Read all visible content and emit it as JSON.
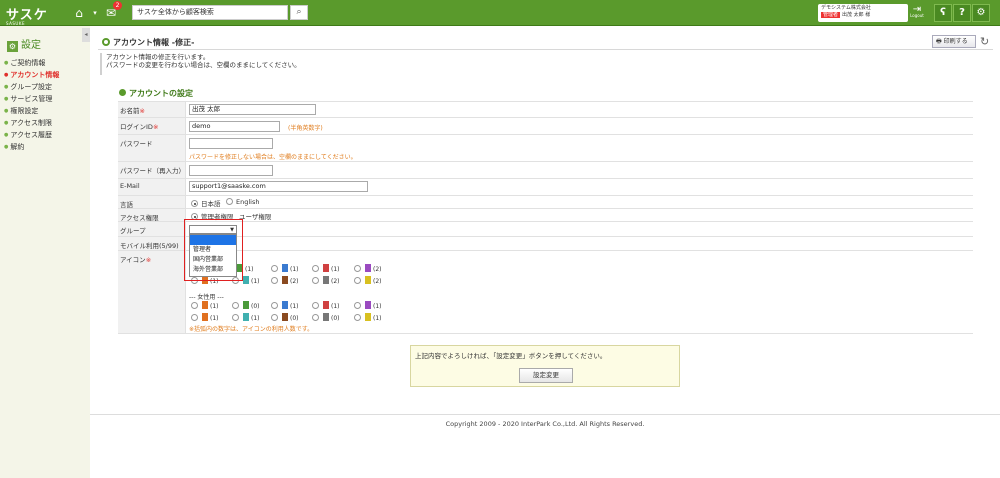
{
  "header": {
    "logo_text": "サスケ",
    "logo_sub": "SASUKE",
    "notification_count": "2",
    "search_placeholder": "サスケ全体から顧客検索",
    "company": "デモシステム株式会社",
    "role": "管理者",
    "user_name": "出茂 太郎 様",
    "logout_label": "Logout",
    "help_label": "?"
  },
  "sidebar": {
    "title": "設定",
    "items": [
      {
        "label": "ご契約情報",
        "active": false
      },
      {
        "label": "アカウント情報",
        "active": true
      },
      {
        "label": "グループ設定",
        "active": false
      },
      {
        "label": "サービス管理",
        "active": false
      },
      {
        "label": "権限設定",
        "active": false
      },
      {
        "label": "アクセス制限",
        "active": false
      },
      {
        "label": "アクセス履歴",
        "active": false
      },
      {
        "label": "解約",
        "active": false
      }
    ]
  },
  "page": {
    "title": "アカウント情報 -修正-",
    "print_label": "印刷する",
    "desc_line1": "アカウント情報の修正を行います。",
    "desc_line2": "パスワードの変更を行わない場合は、空欄のままにしてください。",
    "section_title": "アカウントの設定"
  },
  "form": {
    "name_label": "お名前",
    "name_value": "出茂 太郎",
    "login_label": "ログインID",
    "login_value": "demo",
    "login_note": "(半角英数字)",
    "password_label": "パスワード",
    "password_note": "パスワードを修正しない場合は、空欄のままにしてください。",
    "password2_label": "パスワード（再入力）",
    "email_label": "E-Mail",
    "email_value": "support1@saaske.com",
    "lang_label": "言語",
    "lang_options": [
      "日本語",
      "English"
    ],
    "access_label": "アクセス権限",
    "access_options": [
      "管理者権限",
      "ユーザ権限"
    ],
    "group_label": "グループ",
    "group_options": [
      "",
      "管理者",
      "国内営業部",
      "海外営業部"
    ],
    "mobile_label": "モバイル利用(5/99)",
    "icon_label": "アイコン",
    "required_mark": "※",
    "female_label": "--- 女性用 ---",
    "icon_note": "※括弧内の数字は、アイコンの利用人数です。",
    "icon_counts_row1": [
      "(1)",
      "(1)",
      "(1)",
      "(2)"
    ],
    "icon_counts_row2": [
      "(1)",
      "(1)",
      "(2)",
      "(2)",
      "(2)"
    ],
    "icon_counts_row3": [
      "(1)",
      "(0)",
      "(1)",
      "(1)",
      "(1)"
    ],
    "icon_counts_row4": [
      "(1)",
      "(1)",
      "(0)",
      "(0)",
      "(1)"
    ]
  },
  "confirm": {
    "text": "上記内容でよろしければ、「設定変更」ボタンを押してください。",
    "button_label": "設定変更"
  },
  "footer": {
    "copyright": "Copyright 2009 - 2020 InterPark Co.,Ltd. All Rights Reserved."
  },
  "colors": {
    "brand": "#5a9a2c",
    "required": "#e0302c",
    "note": "#e07c1c",
    "highlight": "#1e74e6"
  }
}
